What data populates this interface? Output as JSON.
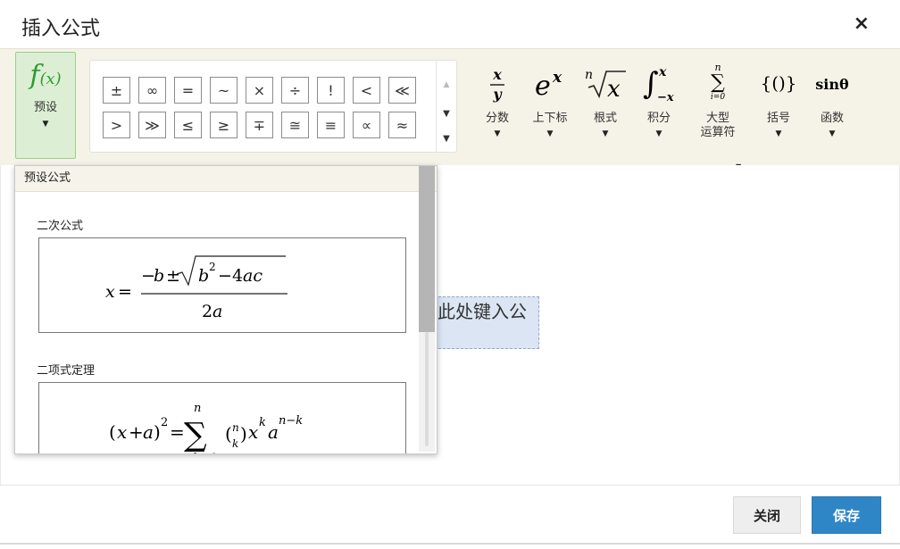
{
  "dialog": {
    "title": "插入公式",
    "close_icon": "×"
  },
  "toolbar": {
    "preset": {
      "icon_text": "f(x)",
      "label": "预设"
    },
    "symbols": [
      "±",
      "∞",
      "=",
      "~",
      "×",
      "÷",
      "!",
      "<",
      "≪",
      ">",
      "≫",
      "≤",
      "≥",
      "∓",
      "≅",
      "≡",
      "∝",
      "≈"
    ],
    "tools": [
      {
        "id": "fraction",
        "label": "分数"
      },
      {
        "id": "script",
        "label": "上下标"
      },
      {
        "id": "radical",
        "label": "根式"
      },
      {
        "id": "integral",
        "label": "积分"
      },
      {
        "id": "large-operator",
        "label": "大型\n运算符"
      },
      {
        "id": "bracket",
        "label": "括号"
      },
      {
        "id": "function",
        "label": "函数"
      }
    ]
  },
  "preset_dropdown": {
    "header": "预设公式",
    "items": [
      {
        "label": "二次公式"
      },
      {
        "label": "二项式定理"
      }
    ]
  },
  "editor": {
    "placeholder": "在此处键入公式"
  },
  "footer": {
    "close_label": "关闭",
    "save_label": "保存"
  },
  "colors": {
    "accent": "#2f86c6",
    "preset_green": "#2f9a32",
    "toolbar_bg": "#f5f3e8",
    "placeholder_bg": "#dbe5f3"
  }
}
